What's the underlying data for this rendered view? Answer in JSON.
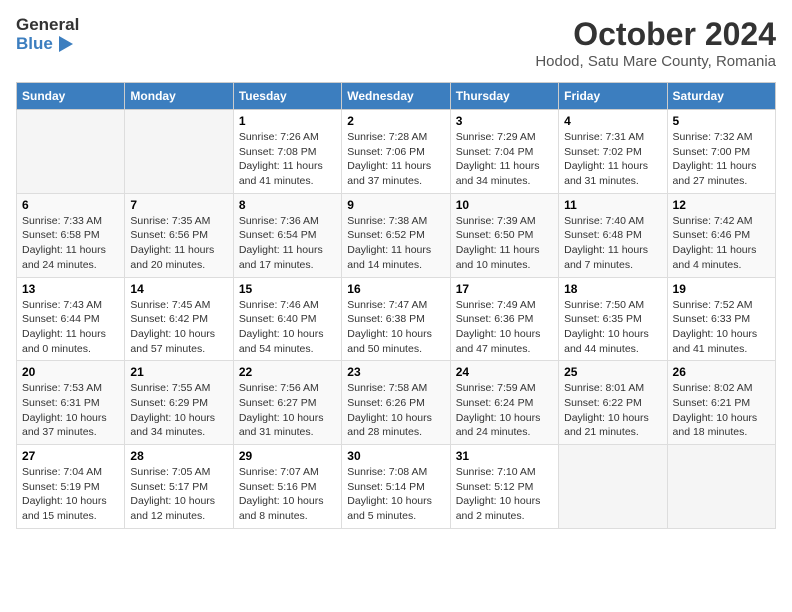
{
  "header": {
    "logo_general": "General",
    "logo_blue": "Blue",
    "month": "October 2024",
    "location": "Hodod, Satu Mare County, Romania"
  },
  "columns": [
    "Sunday",
    "Monday",
    "Tuesday",
    "Wednesday",
    "Thursday",
    "Friday",
    "Saturday"
  ],
  "weeks": [
    [
      {
        "day": "",
        "info": ""
      },
      {
        "day": "",
        "info": ""
      },
      {
        "day": "1",
        "info": "Sunrise: 7:26 AM\nSunset: 7:08 PM\nDaylight: 11 hours and 41 minutes."
      },
      {
        "day": "2",
        "info": "Sunrise: 7:28 AM\nSunset: 7:06 PM\nDaylight: 11 hours and 37 minutes."
      },
      {
        "day": "3",
        "info": "Sunrise: 7:29 AM\nSunset: 7:04 PM\nDaylight: 11 hours and 34 minutes."
      },
      {
        "day": "4",
        "info": "Sunrise: 7:31 AM\nSunset: 7:02 PM\nDaylight: 11 hours and 31 minutes."
      },
      {
        "day": "5",
        "info": "Sunrise: 7:32 AM\nSunset: 7:00 PM\nDaylight: 11 hours and 27 minutes."
      }
    ],
    [
      {
        "day": "6",
        "info": "Sunrise: 7:33 AM\nSunset: 6:58 PM\nDaylight: 11 hours and 24 minutes."
      },
      {
        "day": "7",
        "info": "Sunrise: 7:35 AM\nSunset: 6:56 PM\nDaylight: 11 hours and 20 minutes."
      },
      {
        "day": "8",
        "info": "Sunrise: 7:36 AM\nSunset: 6:54 PM\nDaylight: 11 hours and 17 minutes."
      },
      {
        "day": "9",
        "info": "Sunrise: 7:38 AM\nSunset: 6:52 PM\nDaylight: 11 hours and 14 minutes."
      },
      {
        "day": "10",
        "info": "Sunrise: 7:39 AM\nSunset: 6:50 PM\nDaylight: 11 hours and 10 minutes."
      },
      {
        "day": "11",
        "info": "Sunrise: 7:40 AM\nSunset: 6:48 PM\nDaylight: 11 hours and 7 minutes."
      },
      {
        "day": "12",
        "info": "Sunrise: 7:42 AM\nSunset: 6:46 PM\nDaylight: 11 hours and 4 minutes."
      }
    ],
    [
      {
        "day": "13",
        "info": "Sunrise: 7:43 AM\nSunset: 6:44 PM\nDaylight: 11 hours and 0 minutes."
      },
      {
        "day": "14",
        "info": "Sunrise: 7:45 AM\nSunset: 6:42 PM\nDaylight: 10 hours and 57 minutes."
      },
      {
        "day": "15",
        "info": "Sunrise: 7:46 AM\nSunset: 6:40 PM\nDaylight: 10 hours and 54 minutes."
      },
      {
        "day": "16",
        "info": "Sunrise: 7:47 AM\nSunset: 6:38 PM\nDaylight: 10 hours and 50 minutes."
      },
      {
        "day": "17",
        "info": "Sunrise: 7:49 AM\nSunset: 6:36 PM\nDaylight: 10 hours and 47 minutes."
      },
      {
        "day": "18",
        "info": "Sunrise: 7:50 AM\nSunset: 6:35 PM\nDaylight: 10 hours and 44 minutes."
      },
      {
        "day": "19",
        "info": "Sunrise: 7:52 AM\nSunset: 6:33 PM\nDaylight: 10 hours and 41 minutes."
      }
    ],
    [
      {
        "day": "20",
        "info": "Sunrise: 7:53 AM\nSunset: 6:31 PM\nDaylight: 10 hours and 37 minutes."
      },
      {
        "day": "21",
        "info": "Sunrise: 7:55 AM\nSunset: 6:29 PM\nDaylight: 10 hours and 34 minutes."
      },
      {
        "day": "22",
        "info": "Sunrise: 7:56 AM\nSunset: 6:27 PM\nDaylight: 10 hours and 31 minutes."
      },
      {
        "day": "23",
        "info": "Sunrise: 7:58 AM\nSunset: 6:26 PM\nDaylight: 10 hours and 28 minutes."
      },
      {
        "day": "24",
        "info": "Sunrise: 7:59 AM\nSunset: 6:24 PM\nDaylight: 10 hours and 24 minutes."
      },
      {
        "day": "25",
        "info": "Sunrise: 8:01 AM\nSunset: 6:22 PM\nDaylight: 10 hours and 21 minutes."
      },
      {
        "day": "26",
        "info": "Sunrise: 8:02 AM\nSunset: 6:21 PM\nDaylight: 10 hours and 18 minutes."
      }
    ],
    [
      {
        "day": "27",
        "info": "Sunrise: 7:04 AM\nSunset: 5:19 PM\nDaylight: 10 hours and 15 minutes."
      },
      {
        "day": "28",
        "info": "Sunrise: 7:05 AM\nSunset: 5:17 PM\nDaylight: 10 hours and 12 minutes."
      },
      {
        "day": "29",
        "info": "Sunrise: 7:07 AM\nSunset: 5:16 PM\nDaylight: 10 hours and 8 minutes."
      },
      {
        "day": "30",
        "info": "Sunrise: 7:08 AM\nSunset: 5:14 PM\nDaylight: 10 hours and 5 minutes."
      },
      {
        "day": "31",
        "info": "Sunrise: 7:10 AM\nSunset: 5:12 PM\nDaylight: 10 hours and 2 minutes."
      },
      {
        "day": "",
        "info": ""
      },
      {
        "day": "",
        "info": ""
      }
    ]
  ]
}
